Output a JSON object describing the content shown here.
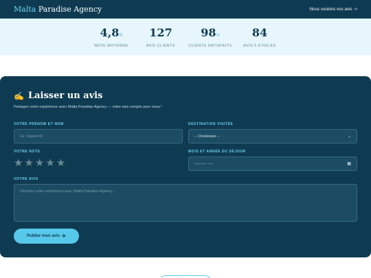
{
  "header": {
    "brand_accent": "Malta",
    "brand_rest": " Paradise Agency",
    "link": "Nous voulons vos avis ->"
  },
  "stats": [
    {
      "value": "4,8",
      "unit": "/5",
      "label": "NOTE MOYENNE"
    },
    {
      "value": "127",
      "unit": "",
      "label": "AVIS CLIENTS"
    },
    {
      "value": "98",
      "unit": "%",
      "label": "CLIENTS SATISFAITS"
    },
    {
      "value": "84",
      "unit": "",
      "label": "AVIS 5 ÉTOILES"
    }
  ],
  "form": {
    "title_icon": "✍",
    "title": "Laisser un avis",
    "subtitle": "Partagez votre expérience avec Malta Paradise Agency — votre avis compte pour nous !",
    "name_label": "VOTRE PRÉNOM ET NOM",
    "name_placeholder": "Ex: Sophie M.",
    "destination_label": "DESTINATION VISITÉE",
    "destination_value": "-- Choisissez --",
    "rating_label": "VOTRE NOTE",
    "rating": 0,
    "rating_max": 5,
    "date_label": "MOIS ET ANNÉE DU SÉJOUR",
    "date_value": "---------- ----",
    "review_label": "VOTRE AVIS",
    "review_placeholder": "Décrivez votre expérience avec Malta Paradise Agency...",
    "submit_label": "Publier mon avis",
    "submit_icon": "✈"
  },
  "colors": {
    "navy": "#0f3b52",
    "accent": "#57c8ea",
    "light_bg": "#e7f6fd"
  }
}
